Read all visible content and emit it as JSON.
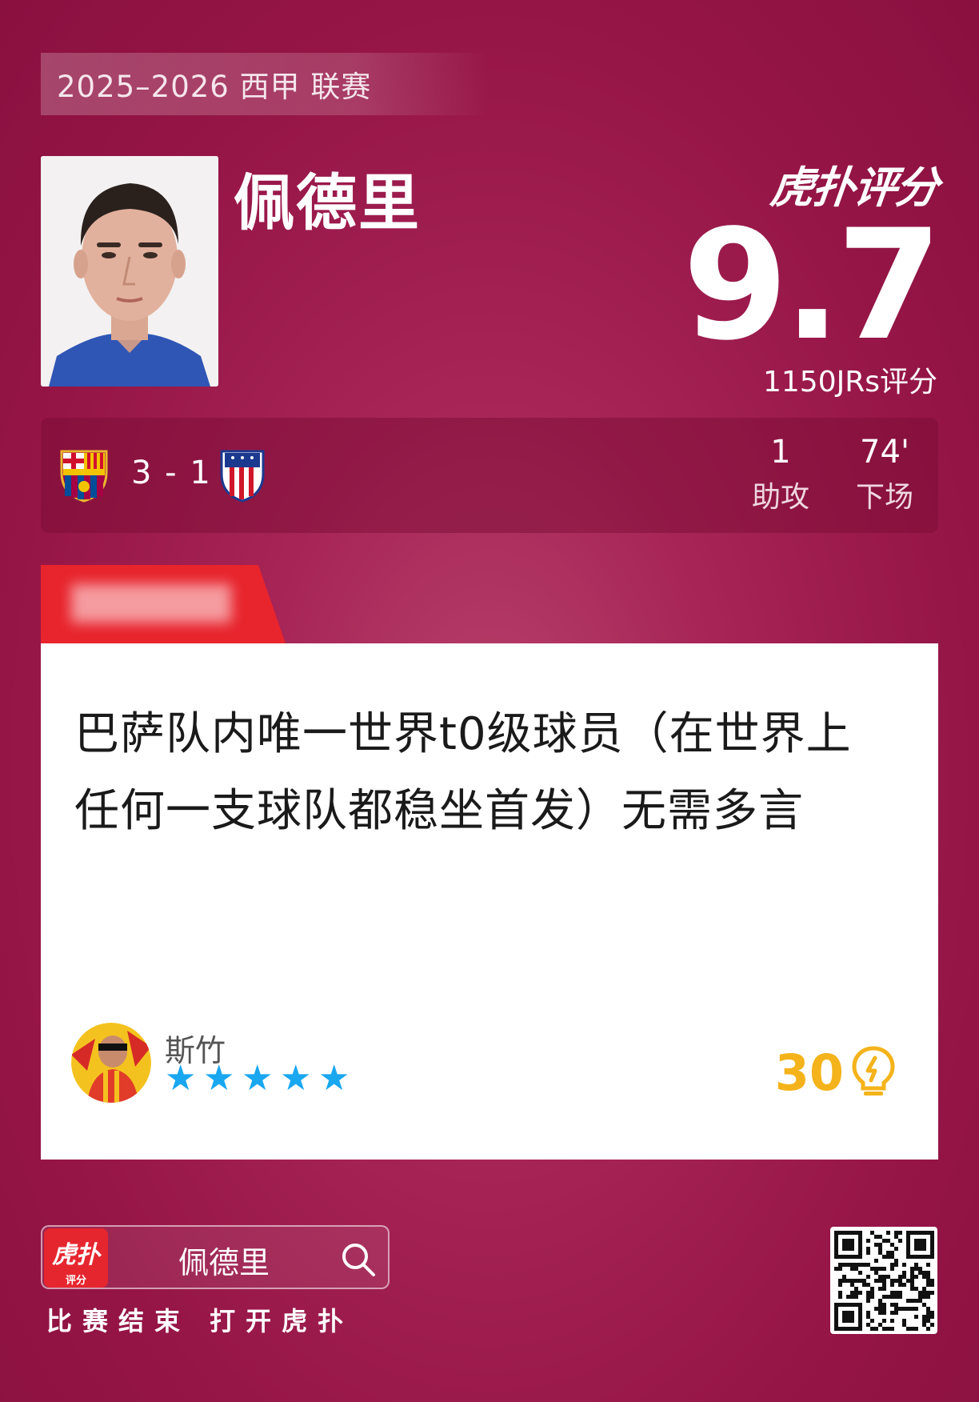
{
  "league_banner": "2025–2026 西甲 联赛",
  "player": {
    "name": "佩德里"
  },
  "brand": {
    "logo_text": "虎扑评分"
  },
  "rating": {
    "score": "9.7",
    "count_text": "1150JRs评分"
  },
  "match": {
    "home_team_icon": "fc-barcelona-crest",
    "away_team_icon": "atletico-madrid-crest",
    "score": "3 - 1",
    "stats": [
      {
        "value": "1",
        "label": "助攻"
      },
      {
        "value": "74'",
        "label": "下场"
      }
    ]
  },
  "comment": {
    "text": "巴萨队内唯一世界t0级球员（在世界上任何一支球队都稳坐首发）无需多言",
    "user": "斯竹",
    "stars": 5,
    "likes": "30",
    "colors": {
      "star": "#19a7f0",
      "likes": "#f4b31a",
      "tag": "#e8242d"
    }
  },
  "footer": {
    "app_icon_main": "虎扑",
    "app_icon_sub": "评分",
    "search_term": "佩德里",
    "caption": "比赛结束 打开虎扑"
  }
}
